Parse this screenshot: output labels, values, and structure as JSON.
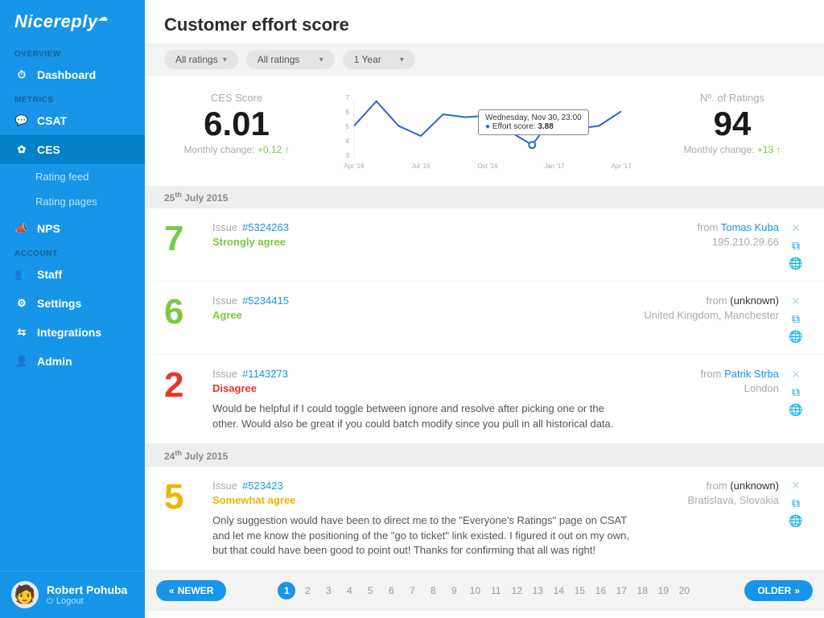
{
  "brand": "Nicereply",
  "page_title": "Customer effort score",
  "sidebar": {
    "sections": {
      "overview": "OVERVIEW",
      "metrics": "METRICS",
      "account": "ACCOUNT"
    },
    "items": {
      "dashboard": "Dashboard",
      "csat": "CSAT",
      "ces": "CES",
      "ces_sub_feed": "Rating feed",
      "ces_sub_pages": "Rating pages",
      "nps": "NPS",
      "staff": "Staff",
      "settings": "Settings",
      "integrations": "Integrations",
      "admin": "Admin"
    }
  },
  "user": {
    "name": "Robert Pohuba",
    "logout": "Logout"
  },
  "filters": [
    {
      "label": "All ratings"
    },
    {
      "label": "All ratings"
    },
    {
      "label": "1 Year"
    }
  ],
  "stats": {
    "score": {
      "label": "CES Score",
      "value": "6.01",
      "change_label": "Monthly change:",
      "change": "+0,12"
    },
    "ratings": {
      "label": "Nº. of Ratings",
      "value": "94",
      "change_label": "Monthly change:",
      "change": "+13"
    }
  },
  "chart_data": {
    "type": "line",
    "x_labels": [
      "Apr '16",
      "Jul '16",
      "Oct '16",
      "Jan '17",
      "Apr '17"
    ],
    "y_ticks": [
      3,
      4,
      5,
      6,
      7
    ],
    "ylim": [
      3,
      7
    ],
    "series": [
      {
        "name": "Effort score",
        "x_idx": [
          0,
          1,
          2,
          3,
          4,
          5,
          6,
          7,
          8,
          9,
          10,
          11,
          12
        ],
        "values": [
          5.2,
          6.9,
          5.2,
          4.5,
          6.0,
          5.8,
          5.9,
          4.8,
          3.88,
          5.9,
          5.0,
          5.2,
          6.2
        ]
      }
    ],
    "tooltip": {
      "header": "Wednesday, Nov 30, 23:00",
      "metric_label": "Effort score:",
      "metric_value": "3.88",
      "point_index": 8
    },
    "color": "#2b67c9"
  },
  "date_headers": {
    "d1": "25",
    "d1_sup": "th",
    "d1_rest": "July 2015",
    "d2": "24",
    "d2_sup": "th",
    "d2_rest": "July 2015"
  },
  "ratings_rows": [
    {
      "score": "7",
      "score_class": "score-7",
      "issue_label": "Issue",
      "issue": "#5324263",
      "from_label": "from",
      "from": "Tomas Kuba",
      "from_link": true,
      "loc": "195.210.29.66",
      "verdict": "Strongly agree",
      "verdict_class": "green",
      "comment": ""
    },
    {
      "score": "6",
      "score_class": "score-6",
      "issue_label": "Issue",
      "issue": "#5234415",
      "from_label": "from",
      "from": "(unknown)",
      "from_link": false,
      "loc": "United Kingdom, Manchester",
      "verdict": "Agree",
      "verdict_class": "green",
      "comment": ""
    },
    {
      "score": "2",
      "score_class": "score-2",
      "issue_label": "Issue",
      "issue": "#1143273",
      "from_label": "from",
      "from": "Patrik Strba",
      "from_link": true,
      "loc": "London",
      "verdict": "Disagree",
      "verdict_class": "red",
      "comment": "Would be helpful if I could toggle between ignore and resolve after picking one or the other. Would also be great if you could batch modify since you pull in all historical data."
    },
    {
      "score": "5",
      "score_class": "score-5",
      "issue_label": "Issue",
      "issue": "#523423",
      "from_label": "from",
      "from": "(unknown)",
      "from_link": false,
      "loc": "Bratislava, Slovakia",
      "verdict": "Somewhat agree",
      "verdict_class": "yellow",
      "comment": "Only suggestion would have been to direct me to the \"Everyone's Ratings\" page on CSAT and let me know the positioning of the \"go to ticket\" link existed. I figured it out on my own, but that could have been good to point out! Thanks for confirming that all was right!"
    }
  ],
  "pager": {
    "newer": "NEWER",
    "older": "OLDER",
    "pages": [
      "1",
      "2",
      "3",
      "4",
      "5",
      "6",
      "7",
      "8",
      "9",
      "10",
      "11",
      "12",
      "13",
      "14",
      "15",
      "16",
      "17",
      "18",
      "19",
      "20"
    ],
    "current": "1"
  }
}
